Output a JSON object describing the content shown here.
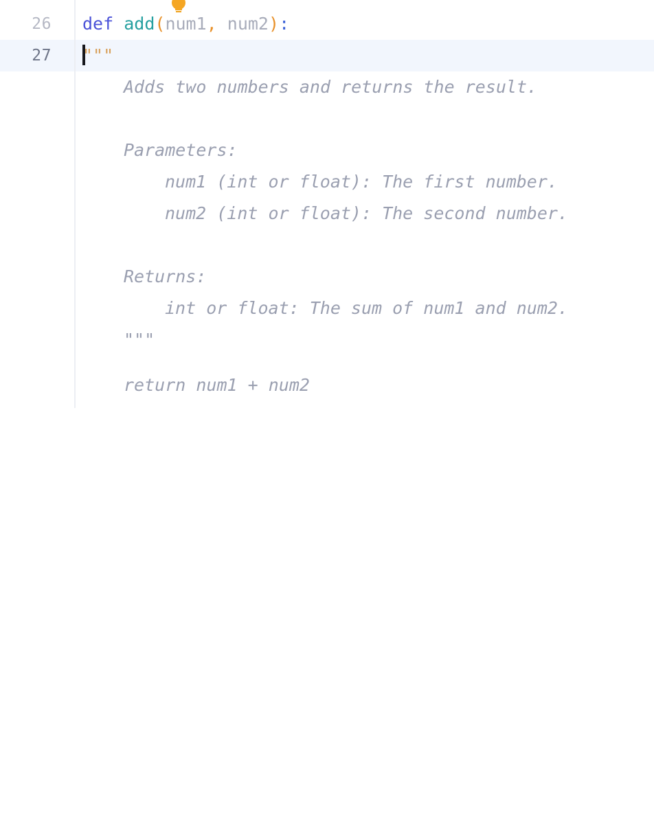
{
  "editor": {
    "language": "python",
    "colors": {
      "background": "#ffffff",
      "active_line": "#f2f6fd",
      "gutter_border": "#eceef3",
      "line_number": "#b5b8c4",
      "line_number_active": "#6e7588",
      "keyword": "#4b52d8",
      "function_name": "#26a0a0",
      "paren": "#e8912a",
      "parameter": "#a8acba",
      "colon": "#3d63d8",
      "quote": "#d8a05a",
      "docstring": "#9a9fb0",
      "caret": "#16171c",
      "bulb": "#f5a623"
    },
    "gutter": {
      "line_numbers": [
        "26",
        "27"
      ],
      "active_line_number": "27"
    },
    "quick_fix": {
      "icon": "lightbulb-icon",
      "tooltip": ""
    },
    "caret": {
      "line": "27",
      "column": "4"
    },
    "code_lines": [
      {
        "number": "26",
        "tokens": [
          {
            "type": "indent",
            "text": ""
          },
          {
            "type": "keyword",
            "text": "def"
          },
          {
            "type": "plain",
            "text": " "
          },
          {
            "type": "funcname",
            "text": "add"
          },
          {
            "type": "paren",
            "text": "("
          },
          {
            "type": "param",
            "text": "num1"
          },
          {
            "type": "comma",
            "text": ","
          },
          {
            "type": "plain",
            "text": " "
          },
          {
            "type": "param",
            "text": "num2"
          },
          {
            "type": "paren",
            "text": ")"
          },
          {
            "type": "colon",
            "text": ":"
          }
        ],
        "plain_text": "def add(num1, num2):"
      },
      {
        "number": "27",
        "tokens": [
          {
            "type": "caret",
            "text": ""
          },
          {
            "type": "quote",
            "text": "\"\"\""
          }
        ],
        "plain_text": "    \"\"\""
      }
    ],
    "docstring_lines": [
      {
        "indent": 4,
        "text": "Adds two numbers and returns the result."
      },
      {
        "indent": 4,
        "text": ""
      },
      {
        "indent": 4,
        "text": "Parameters:"
      },
      {
        "indent": 8,
        "text": "num1 (int or float): The first number."
      },
      {
        "indent": 8,
        "text": "num2 (int or float): The second number."
      },
      {
        "indent": 4,
        "text": ""
      },
      {
        "indent": 4,
        "text": "Returns:"
      },
      {
        "indent": 8,
        "text": "int or float: The sum of num1 and num2."
      },
      {
        "indent": 4,
        "text": "\"\"\""
      },
      {
        "indent": 4,
        "text": ""
      },
      {
        "indent": 4,
        "text": "return num1 + num2"
      }
    ]
  }
}
